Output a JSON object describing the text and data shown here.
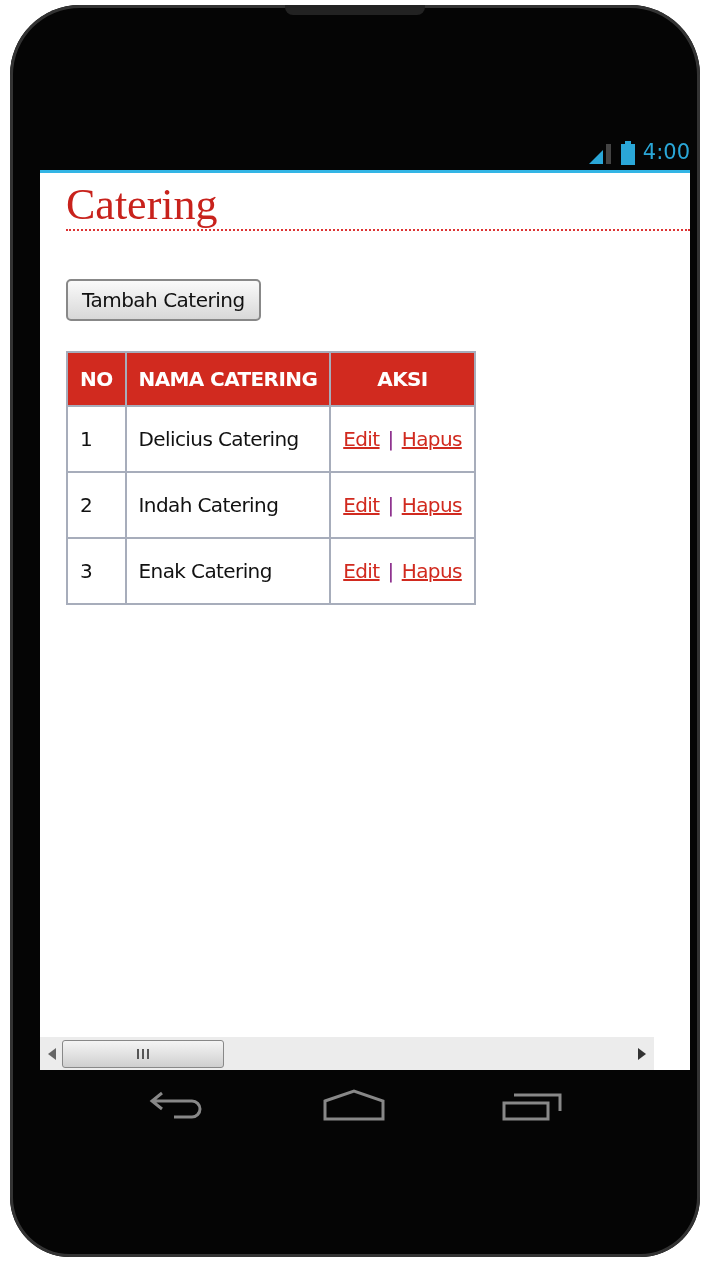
{
  "status_bar": {
    "time": "4:00"
  },
  "page": {
    "title": "Catering",
    "add_button": "Tambah Catering",
    "table": {
      "columns": [
        "NO",
        "NAMA CATERING",
        "AKSI"
      ],
      "rows": [
        {
          "no": "1",
          "name": "Delicius Catering",
          "actions": [
            "Edit",
            "Hapus"
          ],
          "separator": "|"
        },
        {
          "no": "2",
          "name": "Indah Catering",
          "actions": [
            "Edit",
            "Hapus"
          ],
          "separator": "|"
        },
        {
          "no": "3",
          "name": "Enak Catering",
          "actions": [
            "Edit",
            "Hapus"
          ],
          "separator": "|"
        }
      ]
    }
  }
}
